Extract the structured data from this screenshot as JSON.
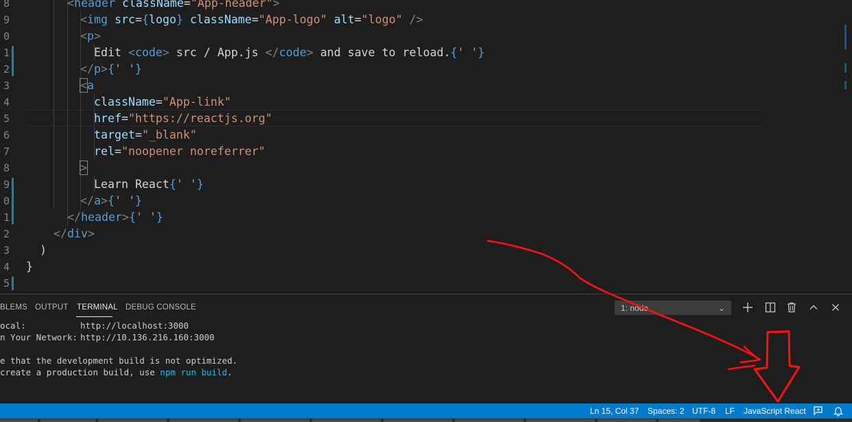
{
  "editor": {
    "lines": [
      {
        "n": "8",
        "tokens": [
          [
            "punct",
            "<"
          ],
          [
            "tag",
            "header"
          ],
          [
            "txt",
            " "
          ],
          [
            "attr",
            "className"
          ],
          [
            "txt",
            "="
          ],
          [
            "str",
            "\"App-header\""
          ],
          [
            "punct",
            ">"
          ]
        ]
      },
      {
        "n": "9",
        "tokens": [
          [
            "punct",
            "<"
          ],
          [
            "tag",
            "img"
          ],
          [
            "txt",
            " "
          ],
          [
            "attr",
            "src"
          ],
          [
            "txt",
            "="
          ],
          [
            "brk",
            "{"
          ],
          [
            "attr",
            "logo"
          ],
          [
            "brk",
            "}"
          ],
          [
            "txt",
            " "
          ],
          [
            "attr",
            "className"
          ],
          [
            "txt",
            "="
          ],
          [
            "str",
            "\"App-logo\""
          ],
          [
            "txt",
            " "
          ],
          [
            "attr",
            "alt"
          ],
          [
            "txt",
            "="
          ],
          [
            "str",
            "\"logo\""
          ],
          [
            "txt",
            " "
          ],
          [
            "punct",
            "/>"
          ]
        ]
      },
      {
        "n": "0",
        "tokens": [
          [
            "punct",
            "<"
          ],
          [
            "tag",
            "p"
          ],
          [
            "punct",
            ">"
          ]
        ]
      },
      {
        "n": "1",
        "tokens": [
          [
            "txt",
            "Edit "
          ],
          [
            "punct",
            "<"
          ],
          [
            "tag",
            "code"
          ],
          [
            "punct",
            ">"
          ],
          [
            "txt",
            " src / App.js "
          ],
          [
            "punct",
            "</"
          ],
          [
            "tag",
            "code"
          ],
          [
            "punct",
            ">"
          ],
          [
            "txt",
            " and save to reload."
          ],
          [
            "brk",
            "{"
          ],
          [
            "str",
            "' '"
          ],
          [
            "brk",
            "}"
          ]
        ]
      },
      {
        "n": "2",
        "tokens": [
          [
            "punct",
            "</"
          ],
          [
            "tag",
            "p"
          ],
          [
            "punct",
            ">"
          ],
          [
            "brk",
            "{"
          ],
          [
            "str",
            "' '"
          ],
          [
            "brk",
            "}"
          ]
        ]
      },
      {
        "n": "3",
        "tokens": [
          [
            "punct",
            "<"
          ],
          [
            "tag",
            "a"
          ]
        ]
      },
      {
        "n": "4",
        "tokens": [
          [
            "attr",
            "className"
          ],
          [
            "txt",
            "="
          ],
          [
            "str",
            "\"App-link\""
          ]
        ]
      },
      {
        "n": "5",
        "tokens": [
          [
            "attr",
            "href"
          ],
          [
            "txt",
            "="
          ],
          [
            "str",
            "\"https://reactjs.org\""
          ]
        ]
      },
      {
        "n": "6",
        "tokens": [
          [
            "attr",
            "target"
          ],
          [
            "txt",
            "="
          ],
          [
            "str",
            "\"_blank\""
          ]
        ]
      },
      {
        "n": "7",
        "tokens": [
          [
            "attr",
            "rel"
          ],
          [
            "txt",
            "="
          ],
          [
            "str",
            "\"noopener noreferrer\""
          ]
        ]
      },
      {
        "n": "8",
        "tokens": [
          [
            "punct",
            ">"
          ]
        ]
      },
      {
        "n": "9",
        "tokens": [
          [
            "txt",
            "Learn React"
          ],
          [
            "brk",
            "{"
          ],
          [
            "str",
            "' '"
          ],
          [
            "brk",
            "}"
          ]
        ]
      },
      {
        "n": "0",
        "tokens": [
          [
            "punct",
            "</"
          ],
          [
            "tag",
            "a"
          ],
          [
            "punct",
            ">"
          ],
          [
            "brk",
            "{"
          ],
          [
            "str",
            "' '"
          ],
          [
            "brk",
            "}"
          ]
        ]
      },
      {
        "n": "1",
        "tokens": [
          [
            "punct",
            "</"
          ],
          [
            "tag",
            "header"
          ],
          [
            "punct",
            ">"
          ],
          [
            "brk",
            "{"
          ],
          [
            "str",
            "' '"
          ],
          [
            "brk",
            "}"
          ]
        ]
      },
      {
        "n": "2",
        "tokens": [
          [
            "punct",
            "</"
          ],
          [
            "tag",
            "div"
          ],
          [
            "punct",
            ">"
          ]
        ]
      },
      {
        "n": "3",
        "tokens": [
          [
            "txt",
            ")"
          ]
        ]
      },
      {
        "n": "4",
        "tokens": [
          [
            "txt",
            "}"
          ]
        ]
      },
      {
        "n": "5",
        "tokens": []
      }
    ]
  },
  "panel": {
    "tabs": [
      "BLEMS",
      "OUTPUT",
      "TERMINAL",
      "DEBUG CONSOLE"
    ],
    "active_tab": "TERMINAL",
    "terminal_select": "1: node",
    "buttons": [
      "new-terminal",
      "split-terminal",
      "kill-terminal",
      "maximize-panel",
      "close-panel"
    ],
    "terminal": {
      "local_label": "ocal:",
      "local_url": "http://localhost:3000",
      "network_label": "n Your Network:",
      "network_url": "http://10.136.216.160:3000",
      "note1": "e that the development build is not optimized.",
      "note2_pre": "create a production build, use ",
      "note2_cmd": "npm run build",
      "note2_post": "."
    }
  },
  "status": {
    "position": "Ln 15, Col 37",
    "spaces": "Spaces: 2",
    "encoding": "UTF-8",
    "eol": "LF",
    "language": "JavaScript React"
  },
  "colors": {
    "status_bar": "#007acc",
    "annotation": "#ff0000"
  }
}
